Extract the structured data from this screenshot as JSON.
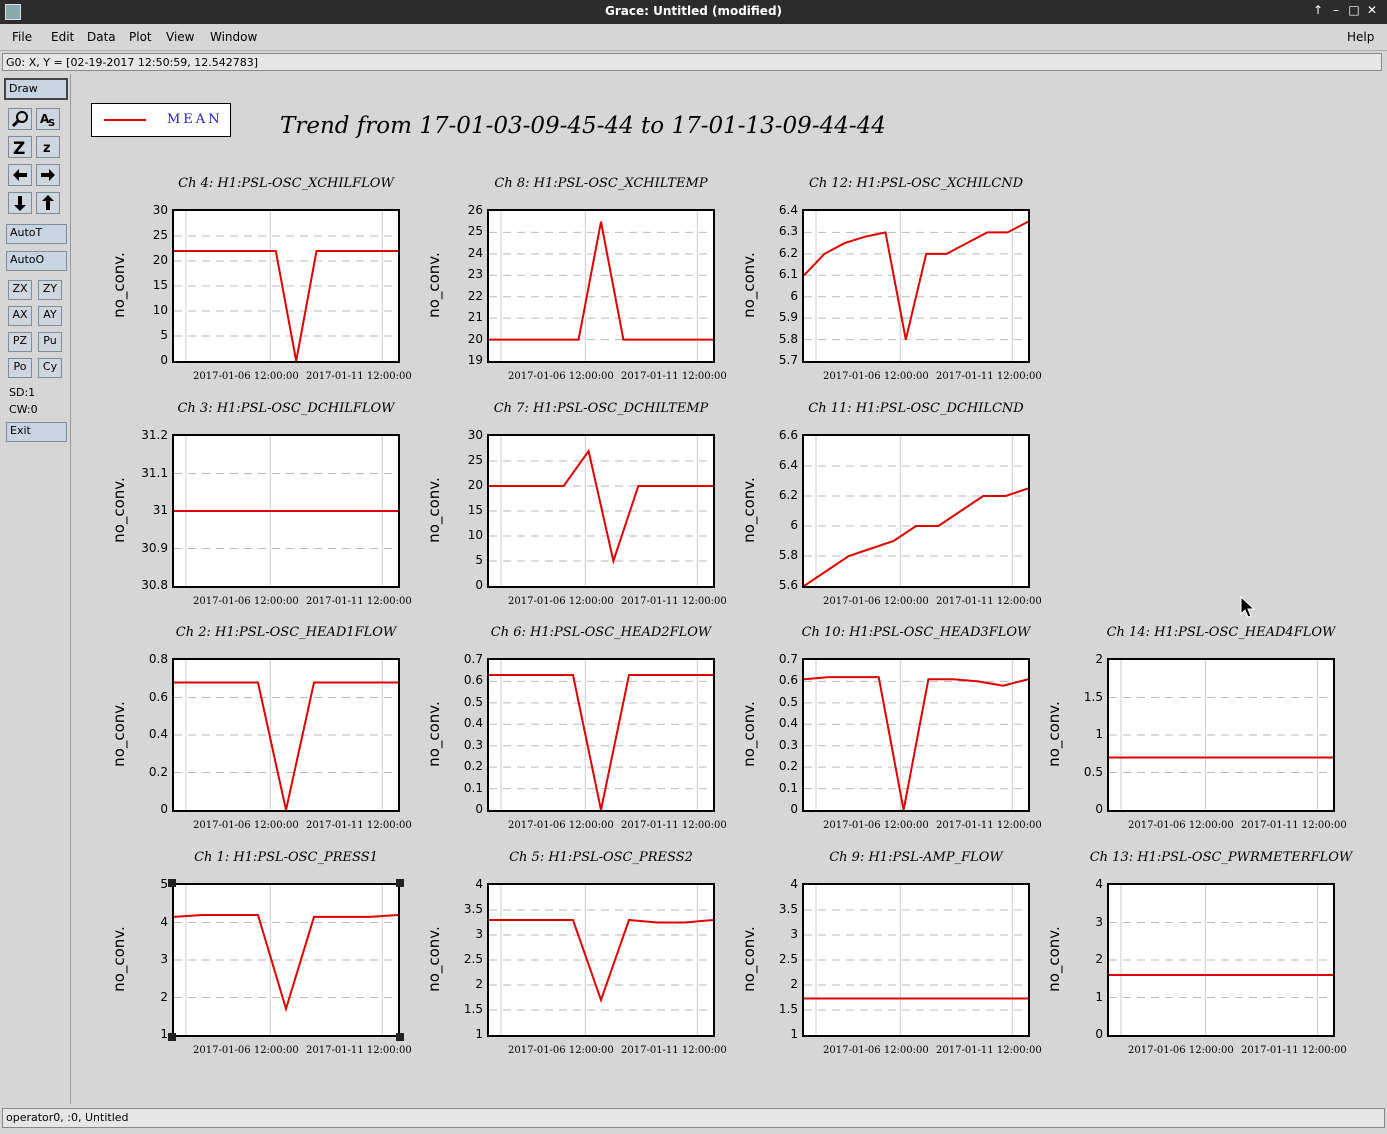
{
  "window": {
    "title": "Grace: Untitled (modified)",
    "controls": [
      "↑",
      "–",
      "□",
      "✕"
    ]
  },
  "menu": {
    "items": [
      "File",
      "Edit",
      "Data",
      "Plot",
      "View",
      "Window"
    ],
    "help": "Help"
  },
  "locator": "G0: X, Y = [02-19-2017 12:50:59, 12.542783]",
  "toolbar": {
    "draw": "Draw",
    "autot": "AutoT",
    "autoo": "AutoO",
    "zoom_buttons": [
      "ZX",
      "ZY",
      "AX",
      "AY",
      "PZ",
      "Pu",
      "Po",
      "Cy"
    ],
    "sd": "SD:1",
    "cw": "CW:0",
    "exit": "Exit"
  },
  "legend": {
    "label": "MEAN",
    "color": "#e00000"
  },
  "main_title": "Trend from 17-01-03-09-45-44 to 17-01-13-09-44-44",
  "status": "operator0, :0, Untitled",
  "ylabel": "no_conv.",
  "xticks": [
    "2017-01-06 12:00:00",
    "2017-01-11 12:00:00"
  ],
  "chart_data": [
    {
      "type": "line",
      "title": "Ch 4: H1:PSL-OSC_XCHILFLOW",
      "ylabel": "no_conv.",
      "ylim": [
        0,
        30
      ],
      "yticks": [
        "0",
        "5",
        "10",
        "15",
        "20",
        "25",
        "30"
      ],
      "x_range": "17-01-03 to 17-01-13",
      "series": [
        {
          "values": [
            22,
            22,
            22,
            22,
            22,
            22,
            0,
            22,
            22,
            22,
            22,
            22
          ]
        }
      ]
    },
    {
      "type": "line",
      "title": "Ch 8: H1:PSL-OSC_XCHILTEMP",
      "ylabel": "no_conv.",
      "ylim": [
        19,
        26
      ],
      "yticks": [
        "19",
        "20",
        "21",
        "22",
        "23",
        "24",
        "25",
        "26"
      ],
      "series": [
        {
          "values": [
            20,
            20,
            20,
            20,
            20,
            25.5,
            20,
            20,
            20,
            20,
            20
          ]
        }
      ]
    },
    {
      "type": "line",
      "title": "Ch 12: H1:PSL-OSC_XCHILCND",
      "ylabel": "no_conv.",
      "ylim": [
        5.7,
        6.4
      ],
      "yticks": [
        "5.7",
        "5.8",
        "5.9",
        "6",
        "6.1",
        "6.2",
        "6.3",
        "6.4"
      ],
      "series": [
        {
          "values": [
            6.1,
            6.2,
            6.25,
            6.28,
            6.3,
            5.8,
            6.2,
            6.2,
            6.25,
            6.3,
            6.3,
            6.35
          ]
        }
      ]
    },
    {
      "type": "line",
      "title": "Ch 3: H1:PSL-OSC_DCHILFLOW",
      "ylabel": "no_conv.",
      "ylim": [
        30.8,
        31.2
      ],
      "yticks": [
        "30.8",
        "30.9",
        "31",
        "31.1",
        "31.2"
      ],
      "series": [
        {
          "values": [
            31,
            31,
            31,
            31,
            31,
            31,
            31,
            31,
            31,
            31
          ]
        }
      ]
    },
    {
      "type": "line",
      "title": "Ch 7: H1:PSL-OSC_DCHILTEMP",
      "ylabel": "no_conv.",
      "ylim": [
        0,
        30
      ],
      "yticks": [
        "0",
        "5",
        "10",
        "15",
        "20",
        "25",
        "30"
      ],
      "series": [
        {
          "values": [
            20,
            20,
            20,
            20,
            27,
            5,
            20,
            20,
            20,
            20
          ]
        }
      ]
    },
    {
      "type": "line",
      "title": "Ch 11: H1:PSL-OSC_DCHILCND",
      "ylabel": "no_conv.",
      "ylim": [
        5.6,
        6.6
      ],
      "yticks": [
        "5.6",
        "5.8",
        "6",
        "6.2",
        "6.4",
        "6.6"
      ],
      "series": [
        {
          "values": [
            5.6,
            5.7,
            5.8,
            5.85,
            5.9,
            6.0,
            6.0,
            6.1,
            6.2,
            6.2,
            6.25
          ]
        }
      ]
    },
    {
      "type": "line",
      "title": "Ch 2: H1:PSL-OSC_HEAD1FLOW",
      "ylabel": "no_conv.",
      "ylim": [
        0,
        0.8
      ],
      "yticks": [
        "0",
        "0.2",
        "0.4",
        "0.6",
        "0.8"
      ],
      "series": [
        {
          "values": [
            0.68,
            0.68,
            0.68,
            0.68,
            0,
            0.68,
            0.68,
            0.68,
            0.68
          ]
        }
      ]
    },
    {
      "type": "line",
      "title": "Ch 6: H1:PSL-OSC_HEAD2FLOW",
      "ylabel": "no_conv.",
      "ylim": [
        0,
        0.7
      ],
      "yticks": [
        "0",
        "0.1",
        "0.2",
        "0.3",
        "0.4",
        "0.5",
        "0.6",
        "0.7"
      ],
      "series": [
        {
          "values": [
            0.63,
            0.63,
            0.63,
            0.63,
            0,
            0.63,
            0.63,
            0.63,
            0.63
          ]
        }
      ]
    },
    {
      "type": "line",
      "title": "Ch 10: H1:PSL-OSC_HEAD3FLOW",
      "ylabel": "no_conv.",
      "ylim": [
        0,
        0.7
      ],
      "yticks": [
        "0",
        "0.1",
        "0.2",
        "0.3",
        "0.4",
        "0.5",
        "0.6",
        "0.7"
      ],
      "series": [
        {
          "values": [
            0.61,
            0.62,
            0.62,
            0.62,
            0,
            0.61,
            0.61,
            0.6,
            0.58,
            0.61
          ]
        }
      ]
    },
    {
      "type": "line",
      "title": "Ch 14: H1:PSL-OSC_HEAD4FLOW",
      "ylabel": "no_conv.",
      "ylim": [
        0,
        2
      ],
      "yticks": [
        "0",
        "0.5",
        "1",
        "1.5",
        "2"
      ],
      "series": [
        {
          "values": [
            0.7,
            0.7,
            0.7,
            0.7,
            0.7
          ]
        }
      ]
    },
    {
      "type": "line",
      "title": "Ch 1: H1:PSL-OSC_PRESS1",
      "ylabel": "no_conv.",
      "ylim": [
        1,
        5
      ],
      "yticks": [
        "1",
        "2",
        "3",
        "4",
        "5"
      ],
      "series": [
        {
          "values": [
            4.15,
            4.2,
            4.2,
            4.2,
            1.7,
            4.15,
            4.15,
            4.15,
            4.2
          ]
        }
      ]
    },
    {
      "type": "line",
      "title": "Ch 5: H1:PSL-OSC_PRESS2",
      "ylabel": "no_conv.",
      "ylim": [
        1,
        4
      ],
      "yticks": [
        "1",
        "1.5",
        "2",
        "2.5",
        "3",
        "3.5",
        "4"
      ],
      "series": [
        {
          "values": [
            3.3,
            3.3,
            3.3,
            3.3,
            1.7,
            3.3,
            3.25,
            3.25,
            3.3
          ]
        }
      ]
    },
    {
      "type": "line",
      "title": "Ch 9: H1:PSL-AMP_FLOW",
      "ylabel": "no_conv.",
      "ylim": [
        1,
        4
      ],
      "yticks": [
        "1",
        "1.5",
        "2",
        "2.5",
        "3",
        "3.5",
        "4"
      ],
      "series": [
        {
          "values": [
            1.73,
            1.73,
            1.73,
            1.73,
            1.73
          ]
        }
      ]
    },
    {
      "type": "line",
      "title": "Ch 13: H1:PSL-OSC_PWRMETERFLOW",
      "ylabel": "no_conv.",
      "ylim": [
        0,
        4
      ],
      "yticks": [
        "0",
        "1",
        "2",
        "3",
        "4"
      ],
      "series": [
        {
          "values": [
            1.6,
            1.6,
            1.6,
            1.6,
            1.6
          ]
        }
      ]
    }
  ]
}
